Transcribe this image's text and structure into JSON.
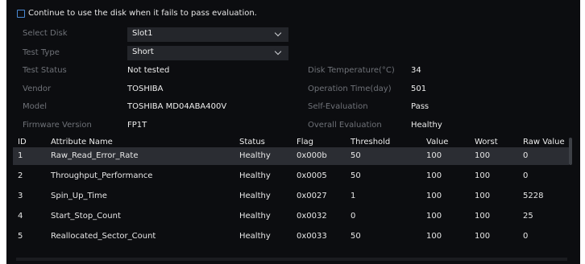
{
  "option": {
    "label": "Continue to use the disk when it fails to pass evaluation."
  },
  "form": {
    "select_disk": {
      "label": "Select Disk",
      "value": "Slot1"
    },
    "test_type": {
      "label": "Test Type",
      "value": "Short"
    },
    "test_status": {
      "label": "Test Status",
      "value": "Not tested"
    },
    "vendor": {
      "label": "Vendor",
      "value": "TOSHIBA"
    },
    "model": {
      "label": "Model",
      "value": "TOSHIBA MD04ABA400V"
    },
    "firmware": {
      "label": "Firmware Version",
      "value": "FP1T"
    },
    "disk_temp": {
      "label": "Disk Temperature(°C)",
      "value": "34"
    },
    "operation_time": {
      "label": "Operation Time(day)",
      "value": "501"
    },
    "self_eval": {
      "label": "Self-Evaluation",
      "value": "Pass"
    },
    "overall_eval": {
      "label": "Overall Evaluation",
      "value": "Healthy"
    }
  },
  "table": {
    "headers": {
      "id": "ID",
      "name": "Attribute Name",
      "status": "Status",
      "flag": "Flag",
      "threshold": "Threshold",
      "value": "Value",
      "worst": "Worst",
      "raw": "Raw Value"
    },
    "rows": [
      {
        "id": "1",
        "name": "Raw_Read_Error_Rate",
        "status": "Healthy",
        "flag": "0x000b",
        "threshold": "50",
        "value": "100",
        "worst": "100",
        "raw": "0"
      },
      {
        "id": "2",
        "name": "Throughput_Performance",
        "status": "Healthy",
        "flag": "0x0005",
        "threshold": "50",
        "value": "100",
        "worst": "100",
        "raw": "0"
      },
      {
        "id": "3",
        "name": "Spin_Up_Time",
        "status": "Healthy",
        "flag": "0x0027",
        "threshold": "1",
        "value": "100",
        "worst": "100",
        "raw": "5228"
      },
      {
        "id": "4",
        "name": "Start_Stop_Count",
        "status": "Healthy",
        "flag": "0x0032",
        "threshold": "0",
        "value": "100",
        "worst": "100",
        "raw": "25"
      },
      {
        "id": "5",
        "name": "Reallocated_Sector_Count",
        "status": "Healthy",
        "flag": "0x0033",
        "threshold": "50",
        "value": "100",
        "worst": "100",
        "raw": "0"
      }
    ]
  },
  "icons": {
    "checkbox": "checkbox-unchecked-icon",
    "dropdown": "chevron-down-icon"
  },
  "colors": {
    "background": "#0c0d10",
    "accent": "#4a8bd6",
    "selected_row": "#2b2d33",
    "input_bg": "#24262b",
    "label": "#6f7278"
  }
}
